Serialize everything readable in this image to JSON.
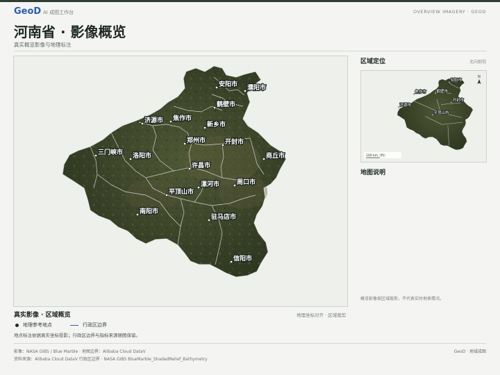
{
  "header": {
    "brand": "GeoD",
    "brand_sub": "AI 成图工作台",
    "top_right": "OVERVIEW IMAGERY · GEOD"
  },
  "page": {
    "title": "河南省 · 影像概览",
    "subtitle": "真实概览影像与地理标注"
  },
  "map": {
    "cities": [
      {
        "name": "安阳市"
      },
      {
        "name": "濮阳市"
      },
      {
        "name": "鹤壁市"
      },
      {
        "name": "济源市"
      },
      {
        "name": "焦作市"
      },
      {
        "name": "新乡市"
      },
      {
        "name": "郑州市"
      },
      {
        "name": "开封市"
      },
      {
        "name": "三门峡市"
      },
      {
        "name": "洛阳市"
      },
      {
        "name": "商丘市"
      },
      {
        "name": "许昌市"
      },
      {
        "name": "周口市"
      },
      {
        "name": "漯河市"
      },
      {
        "name": "平顶山市"
      },
      {
        "name": "南阳市"
      },
      {
        "name": "驻马店市"
      },
      {
        "name": "信阳市"
      }
    ]
  },
  "sidebar": {
    "locator_title": "区域定位",
    "locator_right": "北向朝视",
    "inset_cities": [
      "安阳市",
      "鹤壁市",
      "焦作市",
      "开封市",
      "济源市",
      "平顶山市"
    ],
    "north_label": "N",
    "scale_label": "100 km（约）",
    "legend_title": "地图说明",
    "note": "概览影像按区域裁剪，不代表实时地表情况。"
  },
  "section": {
    "title": "真实影像 · 区域概览",
    "right": "地理坐标对齐 · 区域裁剪",
    "legend_point": "地理参考地点",
    "legend_line": "行政区边界",
    "note": "地点标注依据真实坐标投影；行政区边界与指标来源随图保留。"
  },
  "footer": {
    "line1": "影像：NASA GIBS / Blue Marble · 地图边界：Alibaba Cloud DataV",
    "line2": "资料来源：Alibaba Cloud DataV 行政区边界 · NASA GIBS BlueMarble_ShadedRelief_Bathymetry",
    "right": "GeoD · 地域成图"
  },
  "colors": {
    "brand": "#2a5ea8",
    "terrain_dark": "#2f3a24",
    "terrain_mid": "#4a5232",
    "boundary": "#e8ecef"
  }
}
